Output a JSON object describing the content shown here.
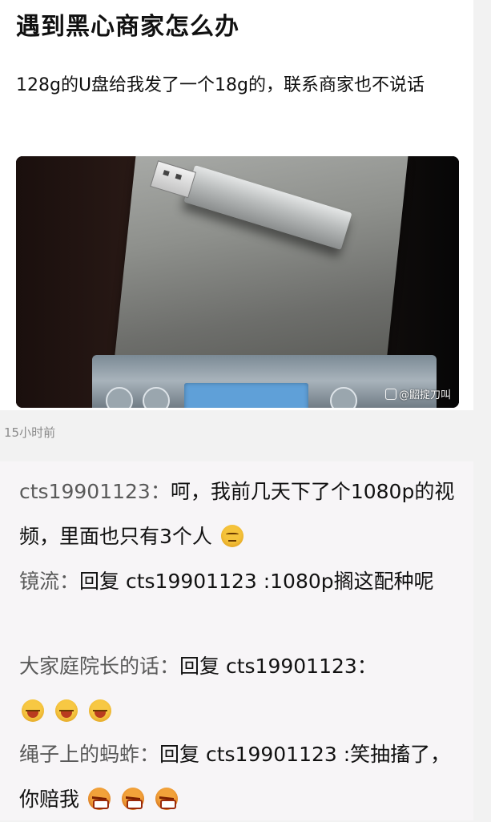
{
  "post": {
    "title": "遇到黑心商家怎么办",
    "body": "128g的U盘给我发了一个18g的，联系商家也不说话",
    "image": {
      "watermark": "@鼦掟刀叫"
    },
    "time": "15小时前"
  },
  "comments": [
    {
      "author": "cts19901123：",
      "text": "呵，我前几天下了个1080p的视频，里面也只有3个人",
      "emojis": [
        "unamused-face-emoji"
      ]
    },
    {
      "author": "镜流：",
      "text": "回复 cts19901123 :1080p搁这配种呢",
      "emojis": []
    },
    {
      "author": "大家庭院长的话：",
      "text": "回复 cts19901123：",
      "emojis": [
        "laughing-face-emoji",
        "laughing-face-emoji",
        "laughing-face-emoji"
      ]
    },
    {
      "author": "绳子上的蚂蚱：",
      "text": "回复 cts19901123 :笑抽搐了，你赔我",
      "emojis": [
        "angry-face-emoji",
        "angry-face-emoji",
        "angry-face-emoji"
      ]
    }
  ]
}
